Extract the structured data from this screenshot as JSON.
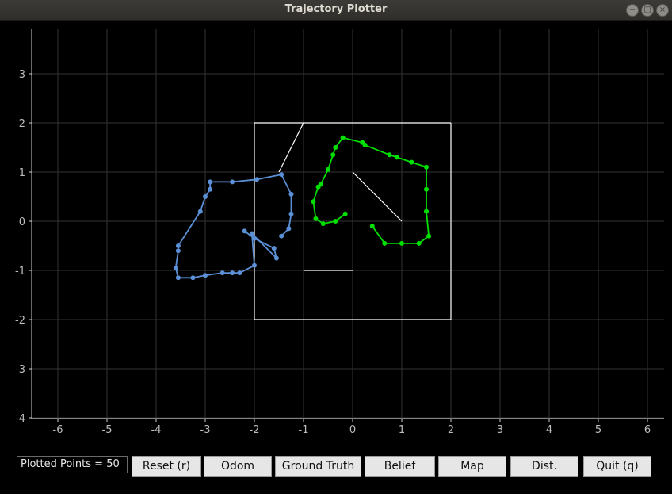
{
  "window": {
    "title": "Trajectory Plotter",
    "controls": {
      "minimize": "−",
      "maximize": "□",
      "close": "×"
    }
  },
  "chart_data": {
    "type": "scatter",
    "xlim": [
      -6.5,
      6.3
    ],
    "ylim": [
      -4,
      3.8
    ],
    "xticks": [
      -6,
      -5,
      -4,
      -3,
      -2,
      -1,
      0,
      1,
      2,
      3,
      4,
      5,
      6
    ],
    "yticks": [
      3,
      2,
      1,
      0,
      -1,
      -2,
      -3,
      -4
    ],
    "grid": true,
    "background_color": "#000000",
    "colors": {
      "odom": "#5b8fd6",
      "ground_truth": "#00e000",
      "map": "#ffffff",
      "grid": "#333333"
    },
    "series": [
      {
        "color": "#5b8fd6",
        "points": [
          [
            -2.2,
            -0.2
          ],
          [
            -2.0,
            -0.35
          ],
          [
            -1.6,
            -0.55
          ],
          [
            -1.55,
            -0.75
          ],
          [
            -2.05,
            -0.25
          ],
          [
            -2.0,
            -0.9
          ],
          [
            -2.3,
            -1.05
          ],
          [
            -2.45,
            -1.05
          ],
          [
            -2.65,
            -1.05
          ],
          [
            -3.0,
            -1.1
          ],
          [
            -3.25,
            -1.15
          ],
          [
            -3.55,
            -1.15
          ],
          [
            -3.6,
            -0.95
          ],
          [
            -3.55,
            -0.6
          ],
          [
            -3.55,
            -0.5
          ],
          [
            -3.1,
            0.2
          ],
          [
            -3.0,
            0.5
          ],
          [
            -2.9,
            0.65
          ],
          [
            -2.9,
            0.8
          ],
          [
            -2.45,
            0.8
          ],
          [
            -1.95,
            0.85
          ],
          [
            -1.45,
            0.95
          ],
          [
            -1.25,
            0.55
          ],
          [
            -1.25,
            0.15
          ],
          [
            -1.3,
            -0.15
          ],
          [
            -1.45,
            -0.3
          ]
        ]
      },
      {
        "color": "#00e000",
        "points": [
          [
            0.4,
            -0.1
          ],
          [
            0.65,
            -0.45
          ],
          [
            1.0,
            -0.45
          ],
          [
            1.35,
            -0.45
          ],
          [
            1.55,
            -0.3
          ],
          [
            1.5,
            0.2
          ],
          [
            1.5,
            0.65
          ],
          [
            1.5,
            1.1
          ],
          [
            1.2,
            1.2
          ],
          [
            0.9,
            1.3
          ],
          [
            0.75,
            1.35
          ],
          [
            0.25,
            1.55
          ],
          [
            0.2,
            1.6
          ],
          [
            -0.2,
            1.7
          ],
          [
            -0.35,
            1.5
          ],
          [
            -0.4,
            1.35
          ],
          [
            -0.5,
            1.05
          ],
          [
            -0.65,
            0.75
          ],
          [
            -0.7,
            0.7
          ],
          [
            -0.8,
            0.4
          ],
          [
            -0.75,
            0.05
          ],
          [
            -0.6,
            -0.05
          ],
          [
            -0.35,
            0.0
          ],
          [
            -0.15,
            0.15
          ]
        ]
      }
    ],
    "map_lines": [
      [
        [
          -2,
          2
        ],
        [
          2,
          2
        ]
      ],
      [
        [
          2,
          2
        ],
        [
          2,
          -2
        ]
      ],
      [
        [
          2,
          -2
        ],
        [
          -2,
          -2
        ]
      ],
      [
        [
          -2,
          -2
        ],
        [
          -2,
          2
        ]
      ],
      [
        [
          -1,
          2
        ],
        [
          -1.5,
          1.0
        ]
      ],
      [
        [
          -1,
          -1
        ],
        [
          0,
          -1
        ]
      ],
      [
        [
          0,
          1
        ],
        [
          1,
          0
        ]
      ]
    ]
  },
  "controls": {
    "counter": "Plotted Points = 50",
    "buttons": [
      "Reset (r)",
      "Odom",
      "Ground Truth",
      "Belief",
      "Map",
      "Dist.",
      "Quit (q)"
    ]
  }
}
